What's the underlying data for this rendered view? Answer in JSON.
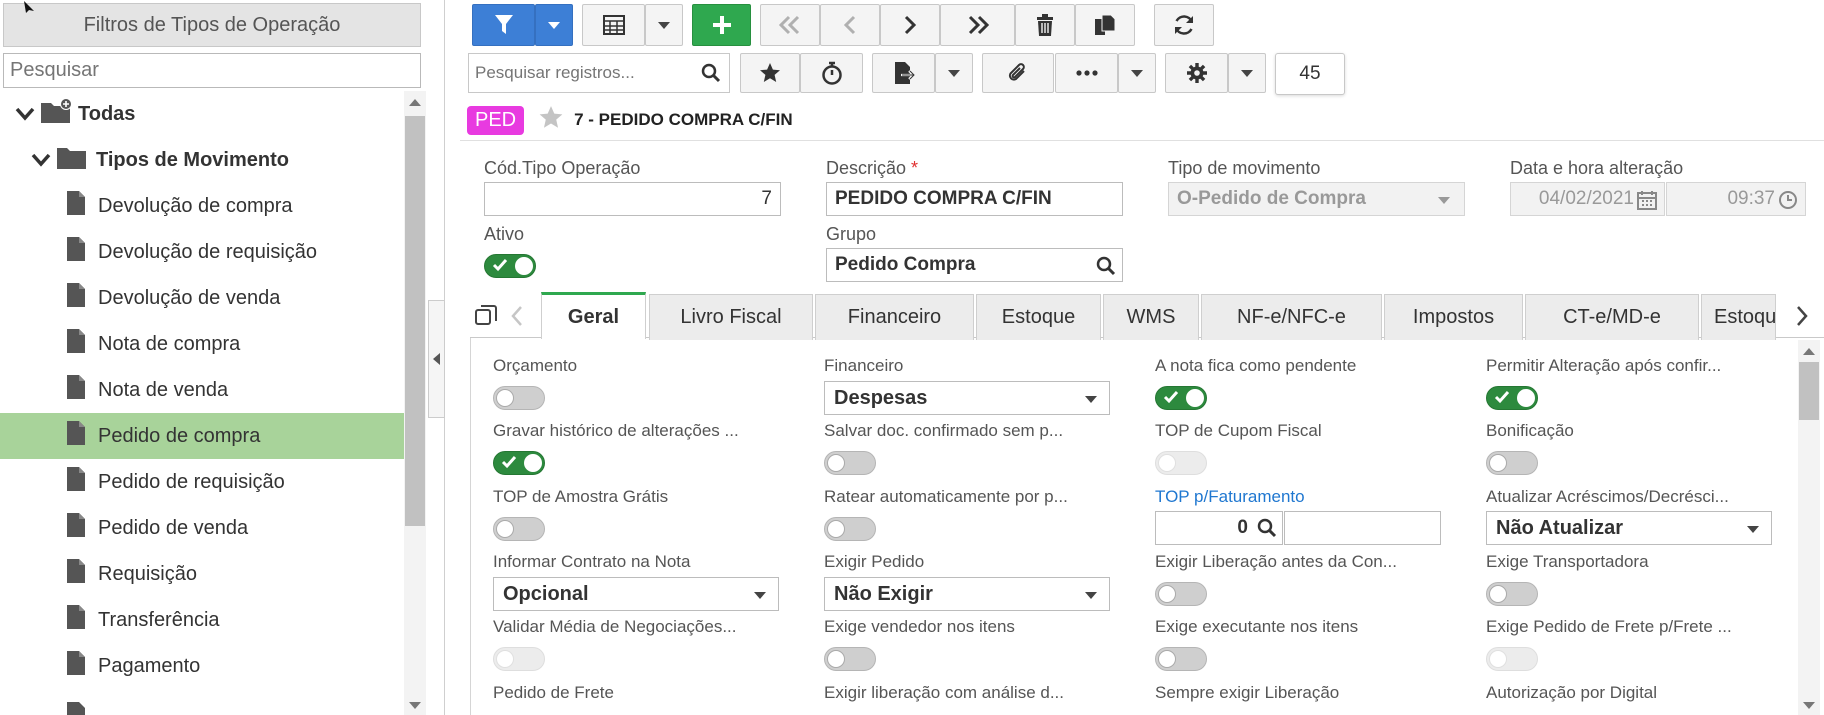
{
  "left_panel": {
    "title": "Filtros de Tipos de Operação",
    "search_placeholder": "Pesquisar",
    "root": "Todas",
    "group": "Tipos de Movimento",
    "items": [
      {
        "label": "Devolução de compra"
      },
      {
        "label": "Devolução de requisição"
      },
      {
        "label": "Devolução de venda"
      },
      {
        "label": "Nota de compra"
      },
      {
        "label": "Nota de venda"
      },
      {
        "label": "Pedido de compra",
        "selected": true
      },
      {
        "label": "Pedido de requisição"
      },
      {
        "label": "Pedido de venda"
      },
      {
        "label": "Requisição"
      },
      {
        "label": "Transferência"
      },
      {
        "label": "Pagamento"
      }
    ]
  },
  "toolbar": {
    "search_placeholder": "Pesquisar registros...",
    "record_count": "45",
    "icons": [
      "filter-icon",
      "grid-icon",
      "add-icon",
      "first-icon",
      "prev-icon",
      "next-icon",
      "last-icon",
      "trash-icon",
      "copy-icon",
      "refresh-icon",
      "star-icon",
      "timer-icon",
      "export-icon",
      "attach-icon",
      "more-icon",
      "gear-icon"
    ]
  },
  "record": {
    "badge": "PED",
    "title": "7 - PEDIDO COMPRA C/FIN"
  },
  "form": {
    "cod_label": "Cód.Tipo Operação",
    "cod_value": "7",
    "desc_label": "Descrição",
    "desc_required": "*",
    "desc_value": "PEDIDO COMPRA C/FIN",
    "tipo_label": "Tipo de movimento",
    "tipo_value": "O-Pedido de Compra",
    "data_label": "Data e hora alteração",
    "data_value": "04/02/2021",
    "hora_value": "09:37",
    "ativo_label": "Ativo",
    "grupo_label": "Grupo",
    "grupo_value": "Pedido Compra"
  },
  "tabs": [
    "Geral",
    "Livro Fiscal",
    "Financeiro",
    "Estoque",
    "WMS",
    "NF-e/NFC-e",
    "Impostos",
    "CT-e/MD-e",
    "Estoqu"
  ],
  "active_tab": "Geral",
  "general": {
    "orcamento": "Orçamento",
    "financeiro": "Financeiro",
    "financeiro_value": "Despesas",
    "nota_pendente": "A nota fica como pendente",
    "permitir_alteracao": "Permitir Alteração após confir...",
    "gravar_historico": "Gravar histórico de alterações ...",
    "salvar_doc": "Salvar doc. confirmado sem p...",
    "top_cupom": "TOP de Cupom Fiscal",
    "bonificacao": "Bonificação",
    "top_amostra": "TOP de Amostra Grátis",
    "ratear": "Ratear automaticamente por p...",
    "top_faturamento": "TOP p/Faturamento",
    "top_faturamento_value": "0",
    "atualizar_acrescimos": "Atualizar Acréscimos/Decrésci...",
    "atualizar_value": "Não Atualizar",
    "informar_contrato": "Informar Contrato na Nota",
    "informar_value": "Opcional",
    "exigir_pedido": "Exigir Pedido",
    "exigir_pedido_value": "Não Exigir",
    "exigir_liberacao": "Exigir Liberação antes da Con...",
    "exige_transportadora": "Exige Transportadora",
    "validar_media": "Validar Média de Negociações...",
    "exige_vendedor": "Exige vendedor nos itens",
    "exige_executante": "Exige executante nos itens",
    "exige_pedido_frete": "Exige Pedido de Frete p/Frete ...",
    "pedido_frete": "Pedido de Frete",
    "exigir_liberacao_analise": "Exigir liberação com análise d...",
    "sempre_exigir": "Sempre exigir Liberação",
    "autorizacao_digital": "Autorização por Digital"
  },
  "colors": {
    "accent_green": "#2fa84f",
    "filter_blue": "#3d7fd6",
    "badge_magenta": "#e83ae0",
    "selection": "#a8d39a",
    "link_blue": "#1f77d0"
  }
}
